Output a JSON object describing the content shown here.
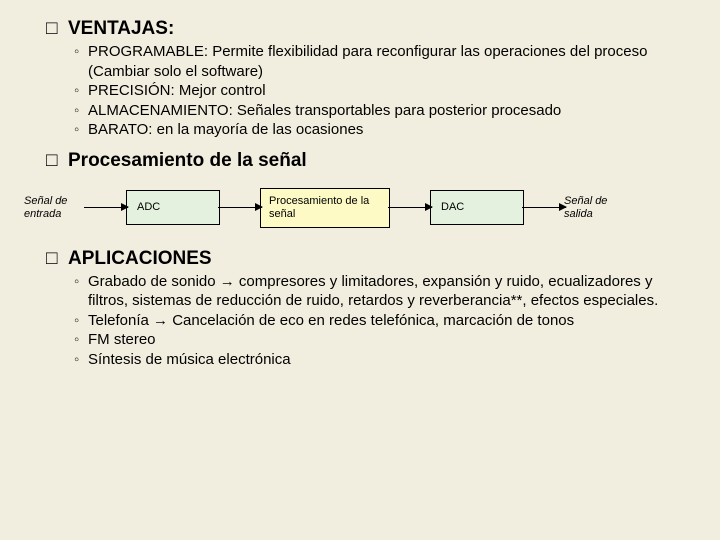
{
  "ventajas": {
    "heading": "VENTAJAS:",
    "items": [
      "PROGRAMABLE: Permite flexibilidad para reconfigurar las operaciones del proceso (Cambiar solo el software)",
      "PRECISIÓN: Mejor control",
      "ALMACENAMIENTO: Señales transportables para posterior procesado",
      "BARATO: en la mayoría de las ocasiones"
    ]
  },
  "procesamiento": {
    "heading": "Procesamiento de la señal"
  },
  "diagram": {
    "input_label": "Señal de entrada",
    "adc": "ADC",
    "proc": "Procesamiento de la señal",
    "dac": "DAC",
    "output_label": "Señal de salida"
  },
  "aplicaciones": {
    "heading": "APLICACIONES",
    "items": [
      "Grabado de sonido →  compresores y limitadores, expansión y ruido, ecualizadores y filtros, sistemas de reducción de ruido, retardos y reverberancia**, efectos especiales.",
      "Telefonía →  Cancelación de eco en redes telefónica, marcación de tonos",
      "FM stereo",
      "Síntesis de música electrónica"
    ]
  }
}
